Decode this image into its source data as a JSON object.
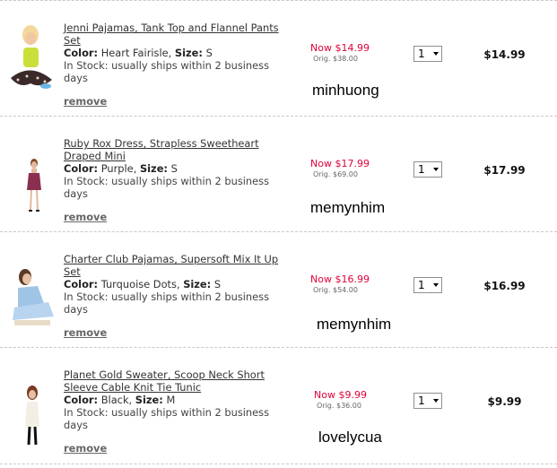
{
  "items": [
    {
      "title": "Jenni Pajamas, Tank Top and Flannel Pants Set",
      "color_label": "Color:",
      "color": "Heart Fairisle",
      "size_label": "Size:",
      "size": "S",
      "stock": "In Stock: usually ships within 2 business days",
      "remove": "remove",
      "price_now": "Now $14.99",
      "price_orig": "Orig. $38.00",
      "qty": "1",
      "total": "$14.99",
      "note": "minhuong"
    },
    {
      "title": "Ruby Rox Dress, Strapless Sweetheart Draped Mini",
      "color_label": "Color:",
      "color": "Purple",
      "size_label": "Size:",
      "size": "S",
      "stock": "In Stock: usually ships within 2 business days",
      "remove": "remove",
      "price_now": "Now $17.99",
      "price_orig": "Orig. $69.00",
      "qty": "1",
      "total": "$17.99",
      "note": "memynhim"
    },
    {
      "title": "Charter Club Pajamas, Supersoft Mix It Up Set",
      "color_label": "Color:",
      "color": "Turquoise Dots",
      "size_label": "Size:",
      "size": "S",
      "stock": "In Stock: usually ships within 2 business days",
      "remove": "remove",
      "price_now": "Now $16.99",
      "price_orig": "Orig. $54.00",
      "qty": "1",
      "total": "$16.99",
      "note": "memynhim"
    },
    {
      "title": "Planet Gold Sweater, Scoop Neck Short Sleeve Cable Knit Tie Tunic",
      "color_label": "Color:",
      "color": "Black",
      "size_label": "Size:",
      "size": "M",
      "stock": "In Stock: usually ships within 2 business days",
      "remove": "remove",
      "price_now": "Now $9.99",
      "price_orig": "Orig. $36.00",
      "qty": "1",
      "total": "$9.99",
      "note": "lovelycua"
    }
  ],
  "colors": {
    "sale": "#e0003a",
    "divider": "#c8c8c8"
  },
  "icons": [
    "product-photo",
    "dropdown-arrow-icon"
  ]
}
